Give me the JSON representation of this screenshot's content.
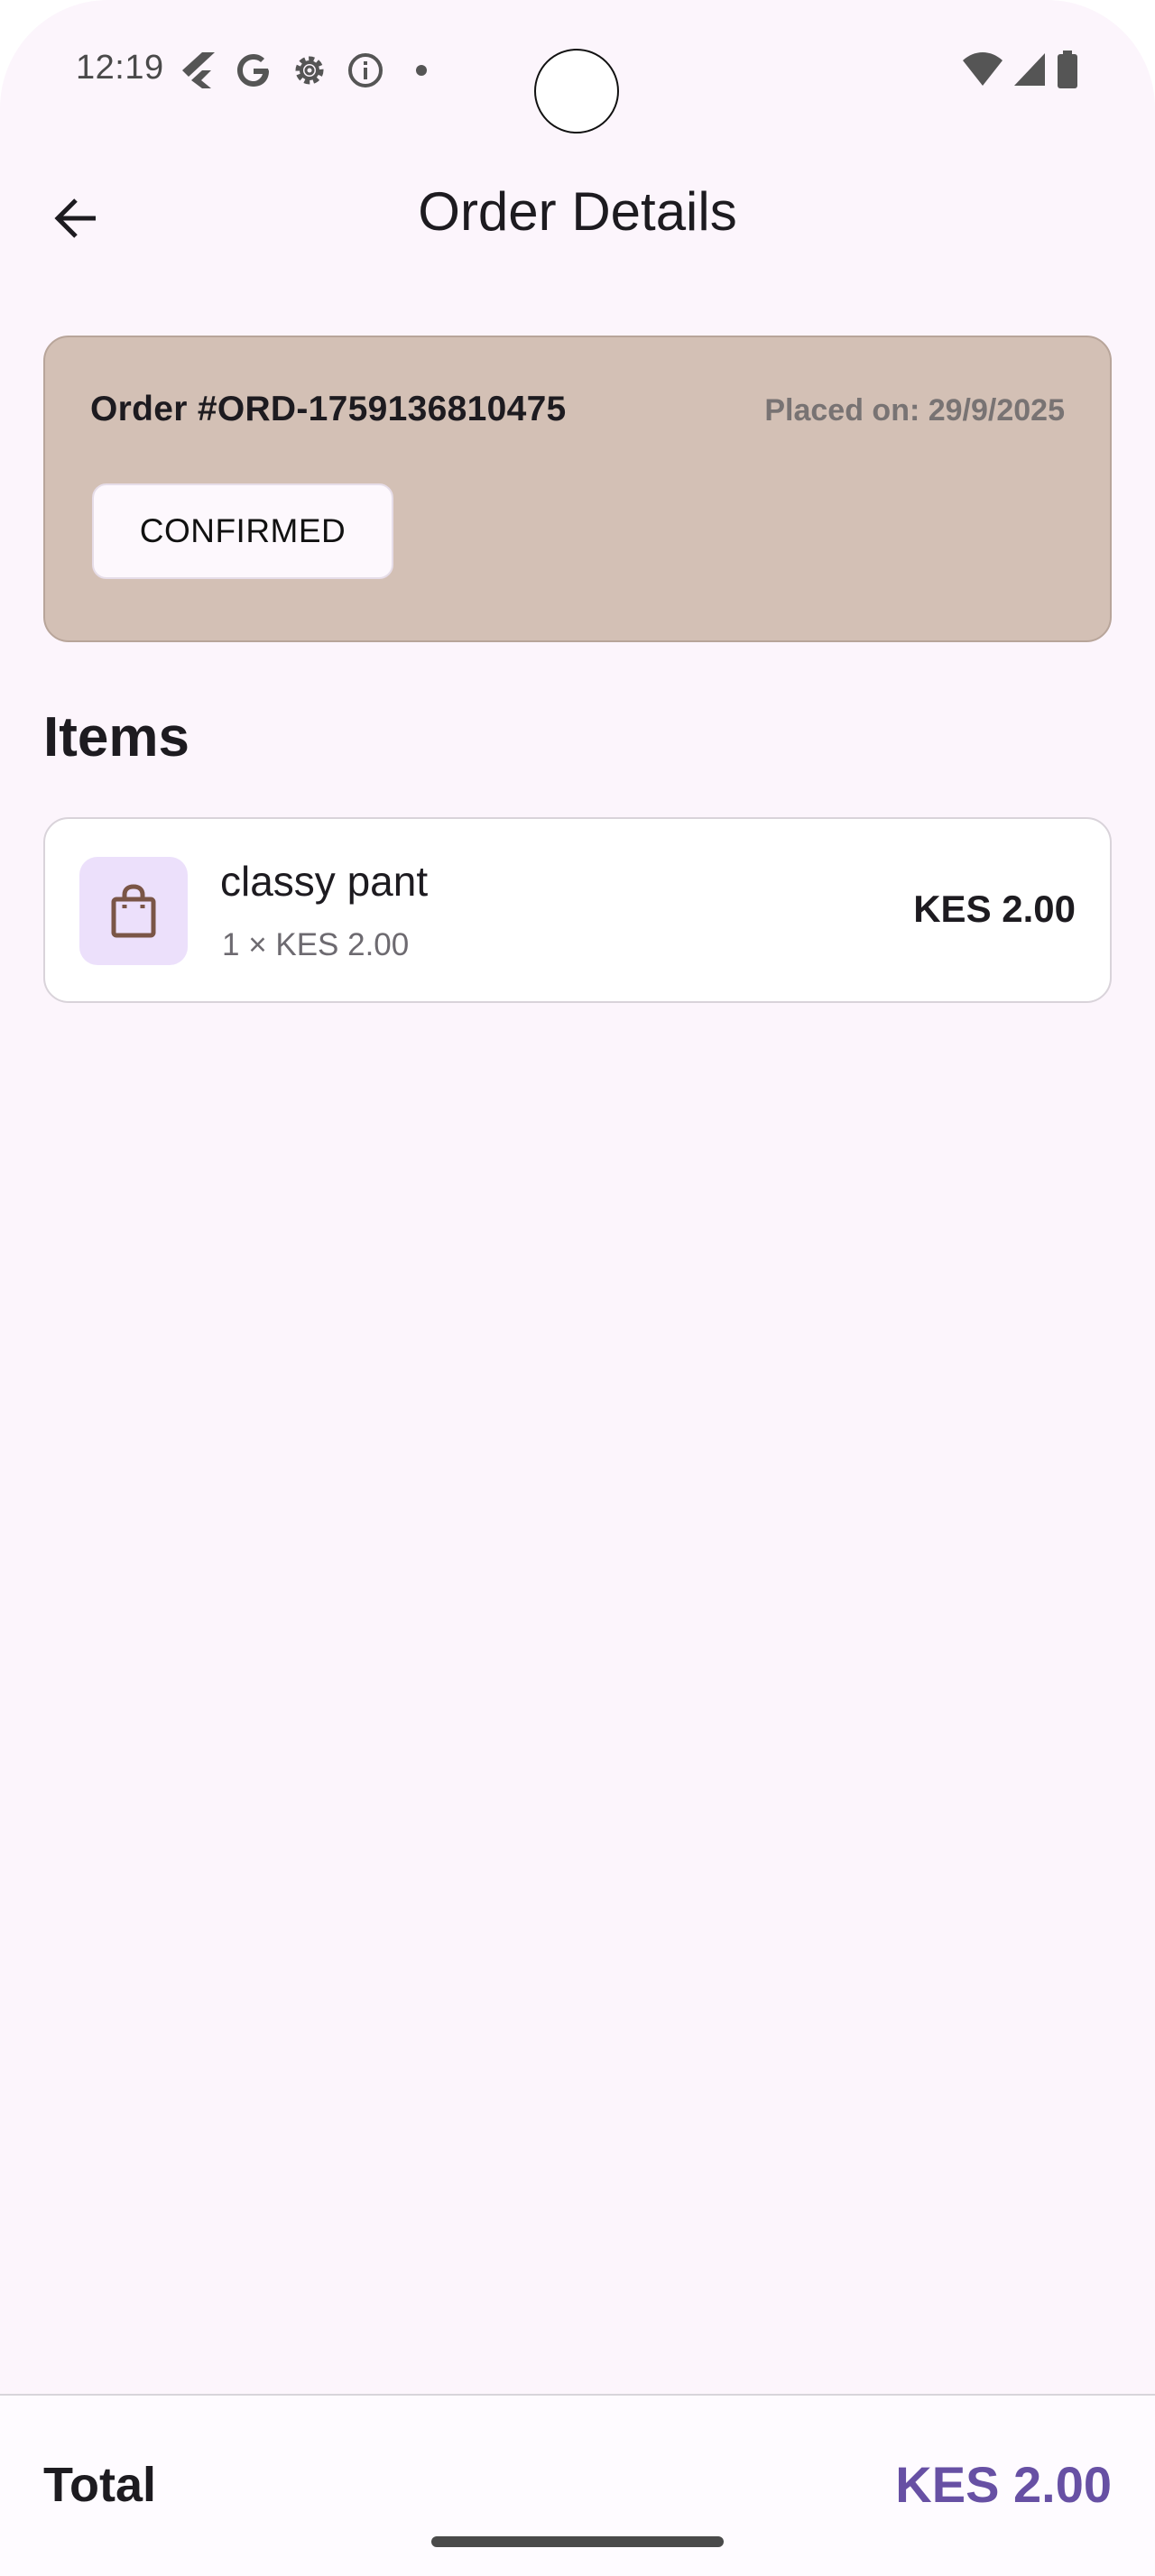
{
  "status_bar": {
    "time": "12:19",
    "icons_left": [
      "flutter-icon",
      "google-icon",
      "settings-gear-icon",
      "info-icon",
      "dot-icon"
    ],
    "icons_right": [
      "wifi-icon",
      "signal-icon",
      "battery-icon"
    ]
  },
  "app_bar": {
    "title": "Order Details",
    "back_icon": "arrow-left-icon"
  },
  "order": {
    "number": "Order #ORD-1759136810475",
    "placed_on": "Placed on: 29/9/2025",
    "status": "CONFIRMED",
    "card_color": "#d3c0b5"
  },
  "items_section": {
    "heading": "Items",
    "items": [
      {
        "name": "classy pant",
        "quantity_line": "1 × KES 2.00",
        "price": "KES 2.00",
        "icon": "shopping-bag-icon"
      }
    ]
  },
  "totals": {
    "label": "Total",
    "value": "KES 2.00",
    "accent_color": "#6750a4"
  }
}
